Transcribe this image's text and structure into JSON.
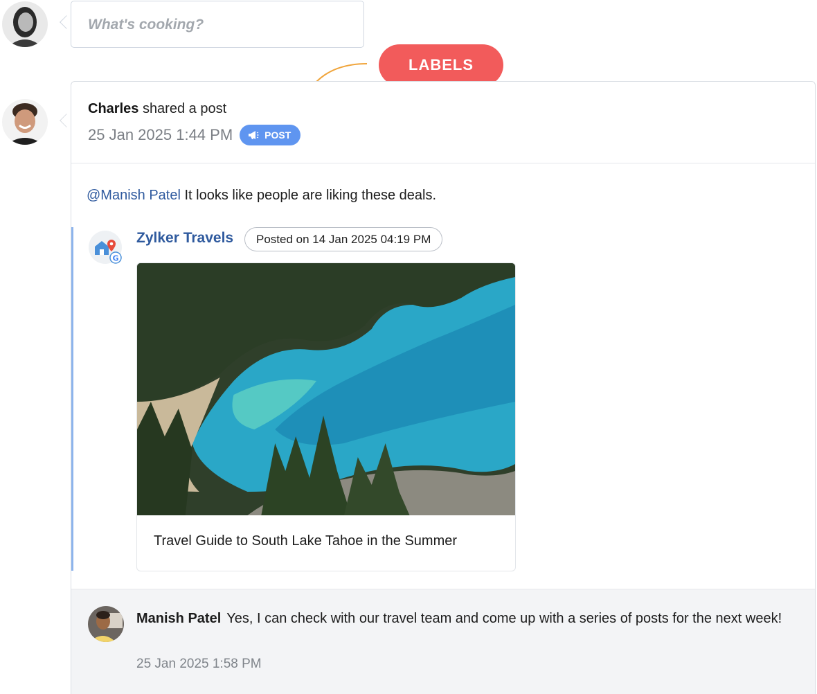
{
  "compose": {
    "placeholder": "What's cooking?"
  },
  "callout": {
    "label": "LABELS"
  },
  "post": {
    "author": "Charles",
    "action": "shared a post",
    "timestamp": "25 Jan 2025 1:44 PM",
    "badge": {
      "label": "POST",
      "icon": "megaphone-icon",
      "color": "#5f95f0"
    },
    "mention": "@Manish Patel",
    "text": "It looks like people are liking these deals.",
    "shared": {
      "source_name": "Zylker Travels",
      "posted_on": "Posted on 14 Jan 2025 04:19 PM",
      "logo_icon": "google-business-icon",
      "link_title": "Travel Guide to South Lake Tahoe in the Summer"
    }
  },
  "comment": {
    "author": "Manish Patel",
    "text": "Yes, I can check with our travel team and come up with a series of posts for the next week!",
    "timestamp": "25 Jan 2025 1:58 PM"
  },
  "colors": {
    "accent_red": "#f25b5b",
    "link_blue": "#2f5a9e",
    "badge_blue": "#5f95f0",
    "shared_bar": "#8db4ec",
    "arrow_orange": "#f0a43a"
  }
}
